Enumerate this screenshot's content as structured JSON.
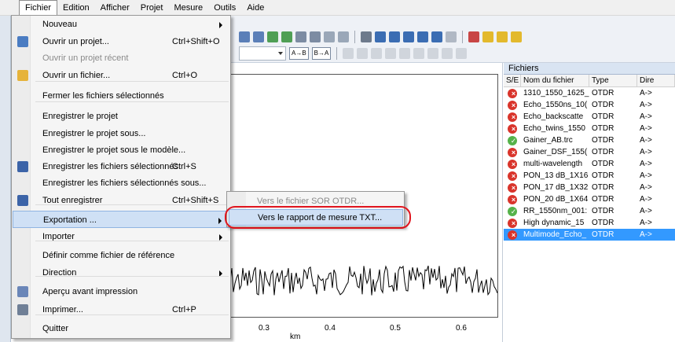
{
  "menubar": {
    "items": [
      "Fichier",
      "Edition",
      "Afficher",
      "Projet",
      "Mesure",
      "Outils",
      "Aide"
    ]
  },
  "file_menu": {
    "items": [
      {
        "label": "Nouveau",
        "submenu": true
      },
      {
        "label": "Ouvrir un projet...",
        "shortcut": "Ctrl+Shift+O",
        "icon": "open-project-icon"
      },
      {
        "label": "Ouvrir un projet récent",
        "disabled": true
      },
      {
        "label": "Ouvrir un fichier...",
        "shortcut": "Ctrl+O",
        "icon": "folder-icon"
      },
      {
        "label": "Fermer les fichiers sélectionnés"
      },
      {
        "label": "Enregistrer le projet"
      },
      {
        "label": "Enregistrer le projet sous..."
      },
      {
        "label": "Enregistrer le projet sous le modèle..."
      },
      {
        "label": "Enregistrer les fichiers sélectionnés",
        "shortcut": "Ctrl+S",
        "icon": "save-icon"
      },
      {
        "label": "Enregistrer les fichiers sélectionnés sous..."
      },
      {
        "label": "Tout enregistrer",
        "shortcut": "Ctrl+Shift+S",
        "icon": "save-all-icon"
      },
      {
        "label": "Exportation ...",
        "submenu": true,
        "highlighted": true
      },
      {
        "label": "Importer",
        "submenu": true
      },
      {
        "label": "Définir comme fichier de référence"
      },
      {
        "label": "Direction",
        "submenu": true
      },
      {
        "label": "Aperçu avant impression",
        "icon": "print-preview-icon"
      },
      {
        "label": "Imprimer...",
        "shortcut": "Ctrl+P",
        "icon": "printer-icon"
      },
      {
        "label": "Quitter"
      }
    ]
  },
  "export_submenu": {
    "items": [
      {
        "label": "Vers le fichier SOR OTDR...",
        "disabled": true
      },
      {
        "label": "Vers le rapport de mesure TXT...",
        "highlighted": true
      }
    ]
  },
  "plot": {
    "x_ticks": [
      "0.3",
      "0.4",
      "0.5",
      "0.6"
    ],
    "x_unit": "km"
  },
  "files_panel": {
    "title": "Fichiers",
    "headers": [
      "S/E",
      "Nom du fichier",
      "Type",
      "Dire"
    ],
    "rows": [
      {
        "status": "error",
        "name": "1310_1550_1625_",
        "type": "OTDR",
        "dir": "A->"
      },
      {
        "status": "error",
        "name": "Echo_1550ns_10(",
        "type": "OTDR",
        "dir": "A->"
      },
      {
        "status": "error",
        "name": "Echo_backscatte",
        "type": "OTDR",
        "dir": "A->"
      },
      {
        "status": "error",
        "name": "Echo_twins_1550",
        "type": "OTDR",
        "dir": "A->"
      },
      {
        "status": "ok",
        "name": "Gainer_AB.trc",
        "type": "OTDR",
        "dir": "A->"
      },
      {
        "status": "error",
        "name": "Gainer_DSF_155(",
        "type": "OTDR",
        "dir": "A->"
      },
      {
        "status": "error",
        "name": "multi-wavelength",
        "type": "OTDR",
        "dir": "A->"
      },
      {
        "status": "error",
        "name": "PON_13 dB_1X16",
        "type": "OTDR",
        "dir": "A->"
      },
      {
        "status": "error",
        "name": "PON_17 dB_1X32",
        "type": "OTDR",
        "dir": "A->"
      },
      {
        "status": "error",
        "name": "PON_20 dB_1X64",
        "type": "OTDR",
        "dir": "A->"
      },
      {
        "status": "ok",
        "name": "RR_1550nm_001:",
        "type": "OTDR",
        "dir": "A->"
      },
      {
        "status": "error",
        "name": "High dynamic_15",
        "type": "OTDR",
        "dir": "A->"
      },
      {
        "status": "error",
        "name": "Multimode_Echo_",
        "type": "OTDR",
        "dir": "A->",
        "selected": true
      }
    ]
  },
  "toolbar": {
    "ab_label": "A→B",
    "ba_label": "B→A"
  },
  "colors": {
    "accent": "#3399ff",
    "highlight": "#cfe0f5",
    "annotation": "#e0151e"
  }
}
